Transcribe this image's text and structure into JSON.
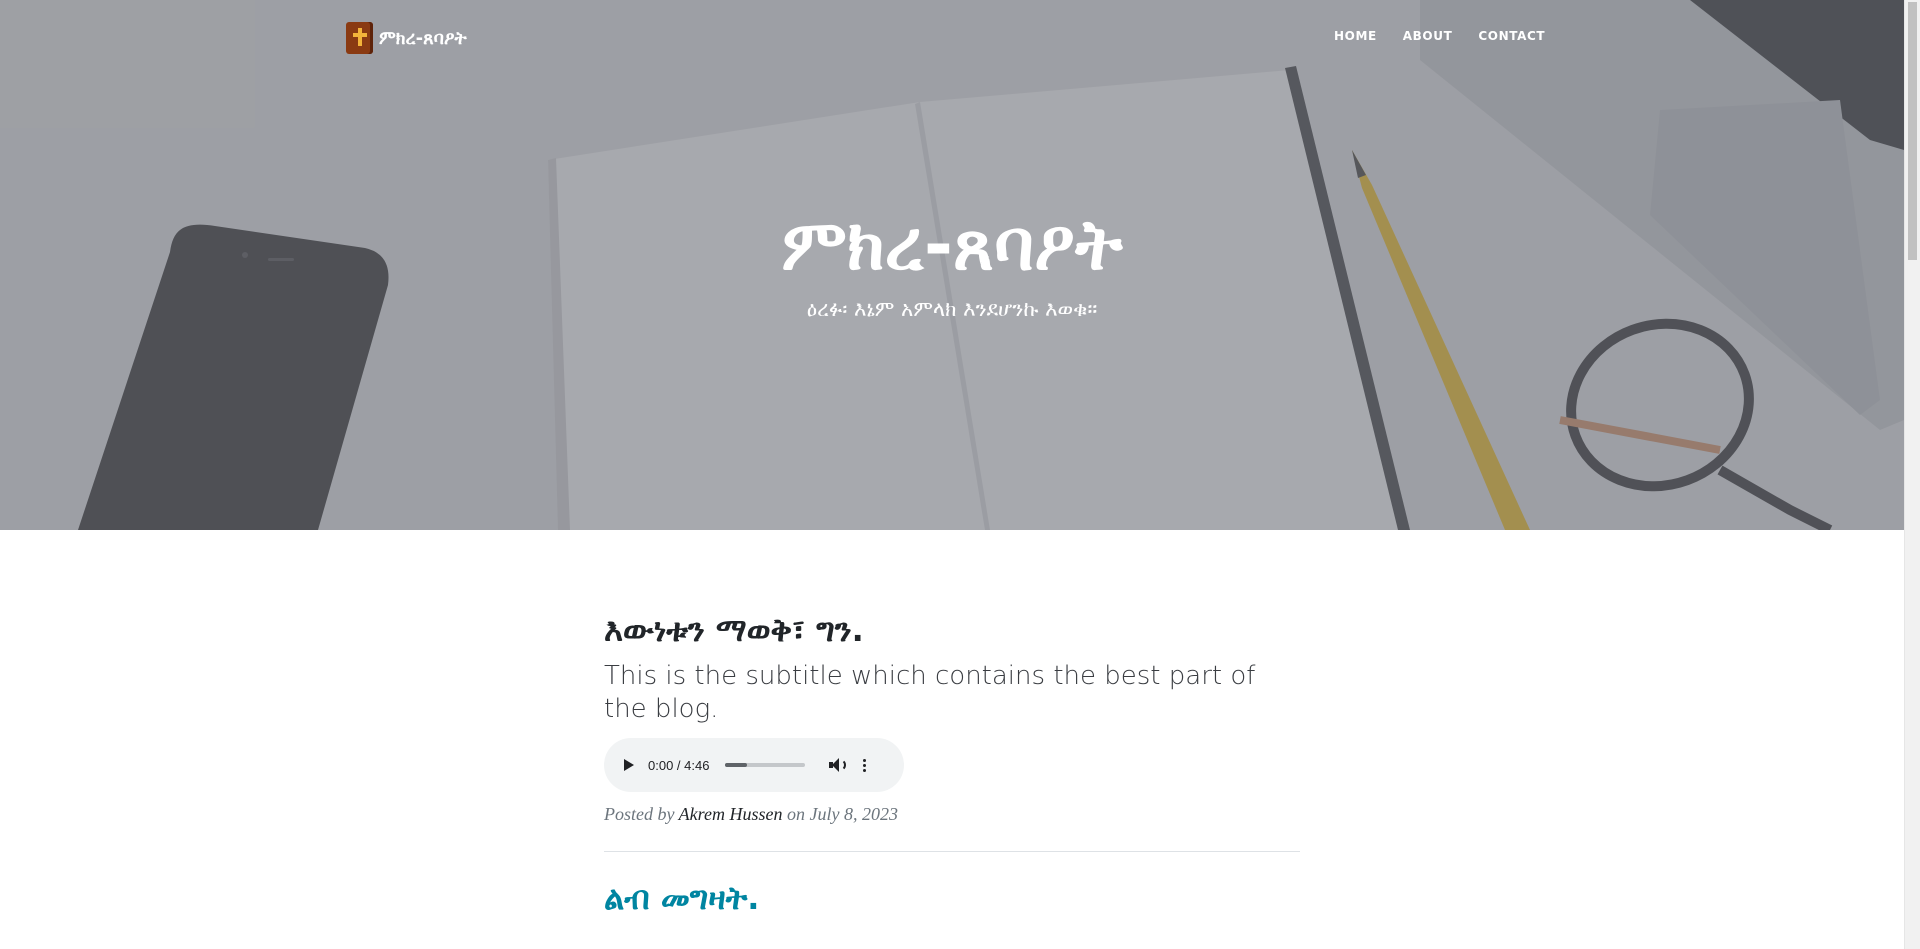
{
  "navbar": {
    "brand_name": "ምክረ-ጸባዖት",
    "brand_logo": "bible-cross-icon",
    "links": [
      {
        "label": "HOME"
      },
      {
        "label": "ABOUT"
      },
      {
        "label": "CONTACT"
      }
    ]
  },
  "masthead": {
    "title": "ምክረ-ጸባዖት",
    "subheading": "ዕረፉ፡ እኔም አምላክ እንደሆንኩ እወቁ።"
  },
  "posts": [
    {
      "title": "እውነቱን ማወቅ፣ ግን.",
      "subtitle": "This is the subtitle which contains the best part of the blog.",
      "audio": {
        "time": "0:00 / 4:46",
        "buffered": 0.27
      },
      "meta_prefix": "Posted by",
      "author": "Akrem Hussen",
      "meta_on": "on",
      "date": "July 8, 2023"
    },
    {
      "title": "ልብ መግዛት."
    }
  ],
  "colors": {
    "link": "#0085a1",
    "heading": "#212529",
    "meta": "#6c757d"
  }
}
